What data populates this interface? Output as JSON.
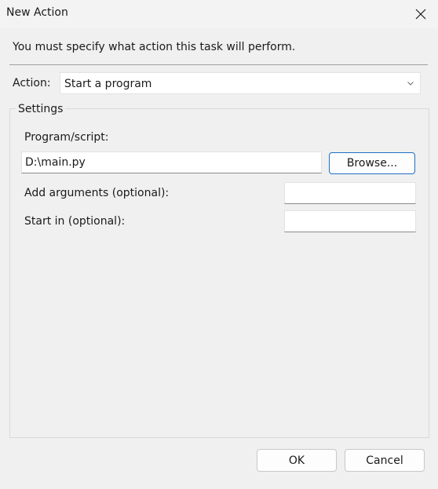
{
  "window": {
    "title": "New Action",
    "close_icon": "close-icon"
  },
  "header": {
    "instruction": "You must specify what action this task will perform."
  },
  "action": {
    "label": "Action:",
    "selected": "Start a program"
  },
  "settings": {
    "legend": "Settings",
    "program_label": "Program/script:",
    "program_value": "D:\\main.py",
    "browse_label": "Browse...",
    "arguments_label": "Add arguments (optional):",
    "arguments_value": "",
    "start_in_label": "Start in (optional):",
    "start_in_value": ""
  },
  "footer": {
    "ok_label": "OK",
    "cancel_label": "Cancel"
  },
  "colors": {
    "accent": "#1f6fc5",
    "window_bg": "#f0f0f0"
  }
}
